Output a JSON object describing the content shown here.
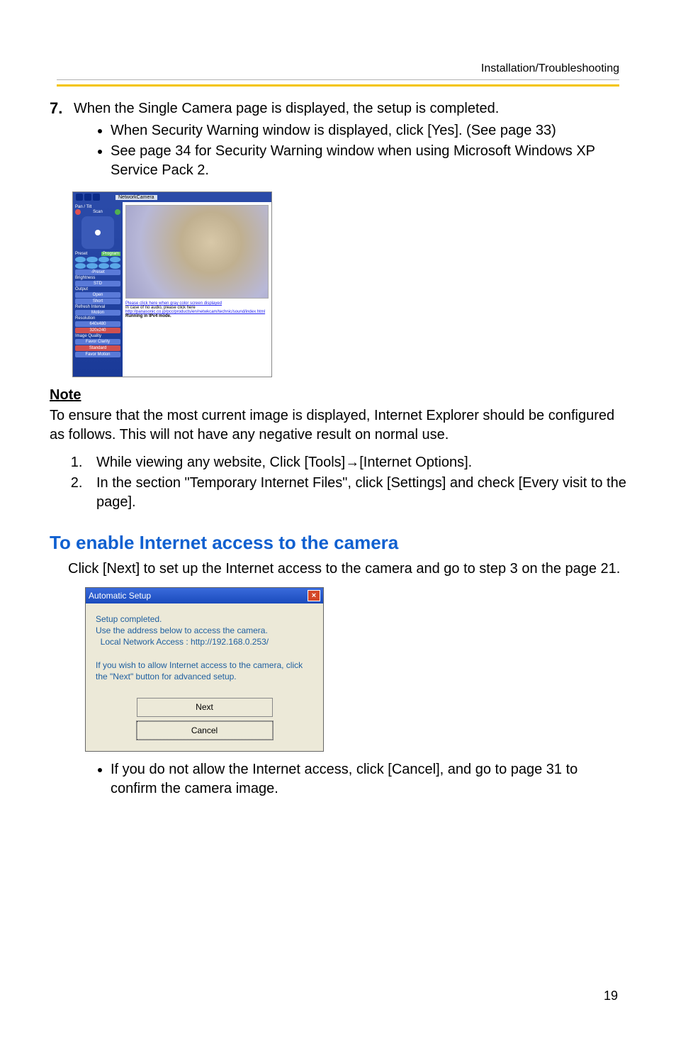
{
  "header": {
    "section": "Installation/Troubleshooting"
  },
  "step": {
    "number": "7.",
    "text": "When the Single Camera page is displayed, the setup is completed.",
    "bullets": [
      "When Security Warning window is displayed, click [Yes]. (See page 33)",
      "See page 34 for Security Warning window when using Microsoft Windows XP Service Pack 2."
    ]
  },
  "screenshot1": {
    "topLabel": "NetworkCamera",
    "side": {
      "panTilt": "Pan / Tilt",
      "scan": "Scan",
      "preset": "Preset",
      "program": "Program",
      "presetSel": "-Preset",
      "brightness": "Brightness",
      "std": "STD",
      "output": "Output",
      "open": "Open",
      "short": "Short",
      "refresh": "Refresh Interval",
      "motion": "Motion",
      "resolution": "Resolution",
      "res1": "640x480",
      "res2": "320x240",
      "quality": "Image Quality",
      "clarity": "Favor Clarity",
      "standard": "Standard",
      "motionQ": "Favor Motion"
    },
    "links": {
      "l1": "Please click here when gray color screen displayed",
      "l2": "In case of no audio, please click here",
      "l3": "http://panasonic.co.jp/pcc/products/en/netwkcam/technic/sound/index.html",
      "l4": "Running in IPv4 mode."
    }
  },
  "note": {
    "heading": "Note",
    "body": "To ensure that the most current image is displayed, Internet Explorer should be configured as follows. This will not have any negative result on normal use.",
    "items": [
      "While viewing any website, Click [Tools]→[Internet Options].",
      "In the section \"Temporary Internet Files\", click [Settings] and check [Every visit to the page]."
    ]
  },
  "section2": {
    "title": "To enable Internet access to the camera",
    "body": "Click [Next] to set up the Internet access to the camera and go to step 3 on the page 21."
  },
  "dialog": {
    "title": "Automatic Setup",
    "closeGlyph": "×",
    "lines": {
      "l1": "Setup completed.",
      "l2": "Use the address below to access the camera.",
      "l3": "  Local Network Access : http://192.168.0.253/",
      "l4": "If you wish to allow Internet access to the camera, click the \"Next\" button for advanced setup."
    },
    "nextLabel": "Next",
    "cancelLabel": "Cancel"
  },
  "postBullet": "If you do not allow the Internet access, click [Cancel], and go to page 31 to confirm the camera image.",
  "pageNumber": "19"
}
